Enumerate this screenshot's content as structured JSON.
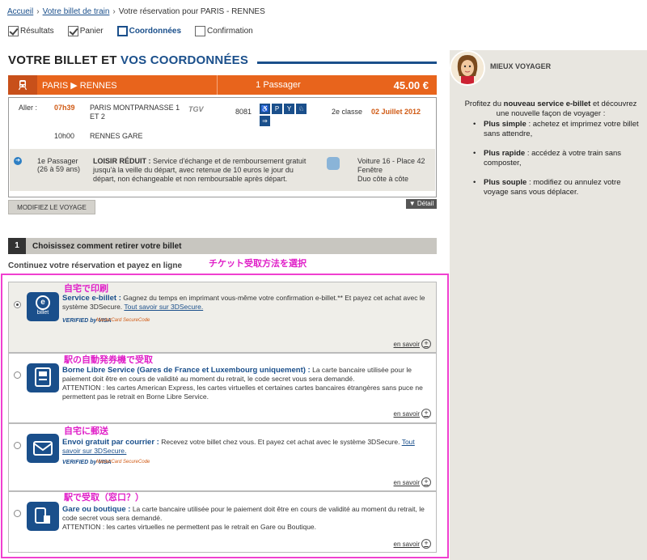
{
  "breadcrumb": {
    "home": "Accueil",
    "ticket": "Votre billet de train",
    "current": "Votre réservation pour PARIS - RENNES"
  },
  "steps": [
    {
      "label": "Résultats",
      "state": "done"
    },
    {
      "label": "Panier",
      "state": "done"
    },
    {
      "label": "Coordonnées",
      "state": "current"
    },
    {
      "label": "Confirmation",
      "state": "todo"
    }
  ],
  "title": {
    "part1": "VOTRE BILLET ET",
    "part2": "VOS COORDONNÉES"
  },
  "summary_bar": {
    "from": "PARIS",
    "to": "RENNES",
    "passengers": "1 Passager",
    "price": "45.00 €"
  },
  "trip": {
    "direction_label": "Aller :",
    "depart_time": "07h39",
    "depart_station": "PARIS MONTPARNASSE 1 ET 2",
    "arrive_time": "10h00",
    "arrive_station": "RENNES GARE",
    "train_brand": "TGV",
    "train_number": "8081",
    "class": "2e classe",
    "date": "02 Juillet 2012",
    "passenger_label": "1e Passager",
    "passenger_age": "(26 à 59 ans)",
    "fare_name": "LOISIR RÉDUIT :",
    "fare_conditions": "Service d'échange et de remboursement gratuit jusqu'à la veille du départ, avec retenue de 10 euros le jour du départ, non échangeable et non remboursable après départ.",
    "seat_line1": "Voiture 16 - Place 42",
    "seat_line2": "Fenêtre",
    "seat_line3": "Duo côte à côte"
  },
  "buttons": {
    "modify": "MODIFIEZ LE VOYAGE",
    "detail": "▼ Détail"
  },
  "section": {
    "number": "1",
    "title": "Choisissez comment retirer votre billet",
    "subtitle": "Continuez votre réservation et payez en ligne"
  },
  "annotations": {
    "top": "チケット受取方法を選択",
    "opt1": "自宅で印刷",
    "opt2": "駅の自動発券機で受取",
    "opt3": "自宅に郵送",
    "opt4": "駅で受取（窓口？）"
  },
  "options": [
    {
      "selected": true,
      "icon_text": "e billet",
      "title": "Service e-billet :",
      "text": "Gagnez du temps en imprimant vous-même votre confirmation e-billet.** Et payez cet achat avec le système 3DSecure.",
      "link": "Tout savoir sur 3DSecure.",
      "verified": "VERIFIED by VISA",
      "mastercard": "MasterCard SecureCode",
      "more": "en savoir"
    },
    {
      "selected": false,
      "title": "Borne Libre Service (Gares de France et Luxembourg uniquement) :",
      "text": "La carte bancaire utilisée pour le paiement doit être en cours de validité au moment du retrait, le code secret vous sera demandé.",
      "text2": "ATTENTION : les cartes American Express, les cartes virtuelles et certaines cartes bancaires étrangères sans puce ne permettent pas le retrait en Borne Libre Service.",
      "more": "en savoir"
    },
    {
      "selected": false,
      "title": "Envoi gratuit par courrier :",
      "text": "Recevez votre billet chez vous. Et payez cet achat avec le système 3DSecure.",
      "link": "Tout savoir sur 3DSecure.",
      "verified": "VERIFIED by VISA",
      "mastercard": "MasterCard SecureCode",
      "more": "en savoir"
    },
    {
      "selected": false,
      "title": "Gare ou boutique :",
      "text": "La carte bancaire utilisée pour le paiement doit être en cours de validité au moment du retrait, le code secret vous sera demandé.",
      "text2": "ATTENTION : les cartes virtuelles ne permettent pas le retrait en Gare ou Boutique.",
      "more": "en savoir"
    }
  ],
  "sidebar": {
    "title": "MIEUX VOYAGER",
    "intro_pre": "Profitez du ",
    "intro_bold": "nouveau service e-billet",
    "intro_post": " et découvrez une nouvelle façon de voyager :",
    "items": [
      {
        "bold": "Plus simple",
        "text": " : achetez et imprimez votre billet sans attendre,"
      },
      {
        "bold": "Plus rapide",
        "text": " : accédez à votre train sans composter,"
      },
      {
        "bold": "Plus souple",
        "text": " : modifiez ou annulez votre voyage sans vous déplacer."
      }
    ]
  }
}
